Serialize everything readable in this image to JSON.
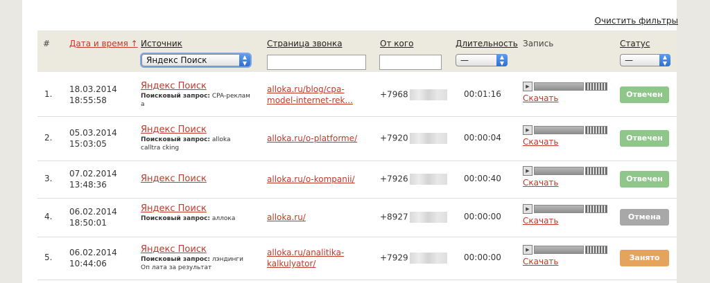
{
  "clear_filters": "Очистить фильтры",
  "headers": {
    "num": "#",
    "datetime": "Дата и время ↑",
    "source": "Источник",
    "page": "Страница звонка",
    "from": "От кого",
    "duration": "Длительность",
    "record": "Запись",
    "status": "Статус"
  },
  "filters": {
    "source_selected": "Яндекс Поиск",
    "duration_selected": "—",
    "status_selected": "—"
  },
  "download_label": "Скачать",
  "query_label": "Поисковый запрос:",
  "colors": {
    "answered": "#8fc78a",
    "cancel": "#a8a8a8",
    "busy": "#e5a45e",
    "link": "#c0392b"
  },
  "rows": [
    {
      "num": "1.",
      "date": "18.03.2014",
      "time": "18:55:58",
      "source": "Яндекс Поиск",
      "query": "CPA-реклам а",
      "page": "alloka.ru/blog/cpa-model-internet-rek...",
      "phone": "+7968",
      "duration": "00:01:16",
      "status": "Отвечен"
    },
    {
      "num": "2.",
      "date": "05.03.2014",
      "time": "15:03:05",
      "source": "Яндекс Поиск",
      "query": "alloka calltra cking",
      "page": "alloka.ru/o-platforme/",
      "phone": "+7920",
      "duration": "00:00:04",
      "status": "Отвечен"
    },
    {
      "num": "3.",
      "date": "07.02.2014",
      "time": "13:48:36",
      "source": "Яндекс Поиск",
      "query": "",
      "page": "alloka.ru/o-kompanii/",
      "phone": "+7926",
      "duration": "00:00:40",
      "status": "Отвечен"
    },
    {
      "num": "4.",
      "date": "06.02.2014",
      "time": "18:50:01",
      "source": "Яндекс Поиск",
      "query": "аллока",
      "page": "alloka.ru/",
      "phone": "+8927",
      "duration": "00:00:00",
      "status": "Отмена"
    },
    {
      "num": "5.",
      "date": "06.02.2014",
      "time": "10:44:06",
      "source": "Яндекс Поиск",
      "query": "лэндинги Оп лата за результат",
      "page": "alloka.ru/analitika-kalkulyator/",
      "phone": "+7929",
      "duration": "00:00:00",
      "status": "Занято"
    }
  ]
}
